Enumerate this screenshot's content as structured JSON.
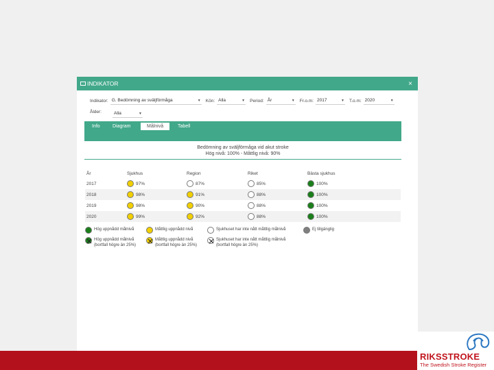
{
  "colors": {
    "green": "#1a7f1a",
    "yellow": "#f1cf00",
    "white": "#ffffff",
    "grey": "#7f7f7f",
    "accent": "#42a88a",
    "brand": "#b3121c"
  },
  "window": {
    "title": "INDIKATOR",
    "close": "×"
  },
  "filters": {
    "indikator_label": "Indikator:",
    "indikator_value": "G. Bedömning av sväljförmåga",
    "kon_label": "Kön:",
    "kon_value": "Alla",
    "period_label": "Period:",
    "period_value": "År",
    "from_label": "Fr.o.m:",
    "from_value": "2017",
    "tom_label": "T.o.m:",
    "tom_value": "2020",
    "alder_label": "Ålder:",
    "alder_value": "Alla"
  },
  "tabs": [
    "Info",
    "Diagram",
    "Målnivå",
    "Tabell"
  ],
  "active_tab": "Målnivå",
  "content": {
    "title": "Bedömning av sväljförmåga vid akut stroke",
    "subtitle": "Hög nivå: 100% - Måttlig nivå: 90%"
  },
  "table": {
    "headers": [
      "År",
      "Sjukhus",
      "Region",
      "Riket",
      "Bästa sjukhus"
    ],
    "rows": [
      {
        "year": "2017",
        "sjukhus": {
          "value": "97%",
          "status": "yellow"
        },
        "region": {
          "value": "87%",
          "status": "white"
        },
        "riket": {
          "value": "85%",
          "status": "white"
        },
        "basta": {
          "value": "100%",
          "status": "green"
        }
      },
      {
        "year": "2018",
        "sjukhus": {
          "value": "98%",
          "status": "yellow"
        },
        "region": {
          "value": "91%",
          "status": "yellow"
        },
        "riket": {
          "value": "88%",
          "status": "white"
        },
        "basta": {
          "value": "100%",
          "status": "green"
        }
      },
      {
        "year": "2019",
        "sjukhus": {
          "value": "98%",
          "status": "yellow"
        },
        "region": {
          "value": "90%",
          "status": "yellow"
        },
        "riket": {
          "value": "88%",
          "status": "white"
        },
        "basta": {
          "value": "100%",
          "status": "green"
        }
      },
      {
        "year": "2020",
        "sjukhus": {
          "value": "99%",
          "status": "yellow"
        },
        "region": {
          "value": "92%",
          "status": "yellow"
        },
        "riket": {
          "value": "88%",
          "status": "white"
        },
        "basta": {
          "value": "100%",
          "status": "green"
        }
      }
    ]
  },
  "legend": {
    "high": "Hög uppnådd målnivå",
    "moderate": "Måttlig uppnådd nivå",
    "not_reached": "Sjukhuset har inte nått måttlig målnivå",
    "unavailable": "Ej tillgänglig",
    "high_dropout": "Hög uppnådd målnivå",
    "moderate_dropout": "Måttlig uppnådd nivå",
    "not_reached_dropout": "Sjukhuset har inte nått måttlig målnivå",
    "dropout_note": "(bortfall högre än 25%)"
  },
  "brand": {
    "name": "RIKSSTROKE",
    "tagline": "The Swedish Stroke Register"
  }
}
